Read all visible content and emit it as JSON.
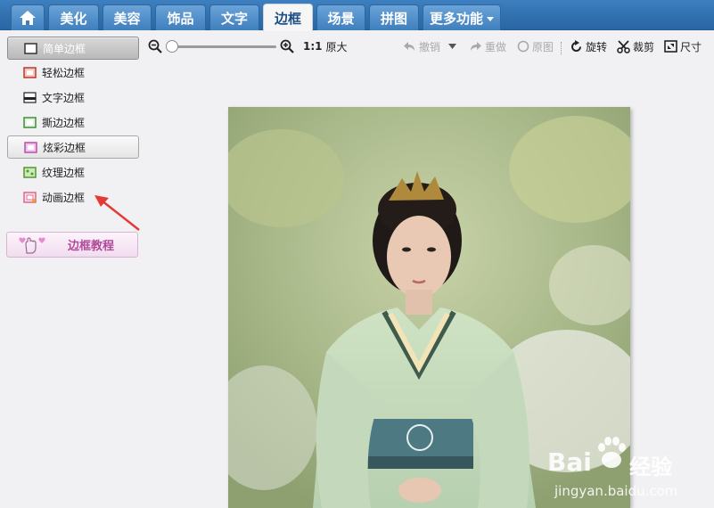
{
  "tabs": [
    {
      "label": "",
      "icon": "home-icon"
    },
    {
      "label": "美化"
    },
    {
      "label": "美容"
    },
    {
      "label": "饰品"
    },
    {
      "label": "文字"
    },
    {
      "label": "边框",
      "active": true
    },
    {
      "label": "场景"
    },
    {
      "label": "拼图"
    },
    {
      "label": "更多功能",
      "has_dropdown": true
    }
  ],
  "sidebar": {
    "items": [
      {
        "label": "简单边框",
        "icon": "simple-frame-icon",
        "state": "selected"
      },
      {
        "label": "轻松边框",
        "icon": "easy-frame-icon"
      },
      {
        "label": "文字边框",
        "icon": "text-frame-icon"
      },
      {
        "label": "撕边边框",
        "icon": "torn-frame-icon"
      },
      {
        "label": "炫彩边框",
        "icon": "colorful-frame-icon",
        "state": "hover"
      },
      {
        "label": "纹理边框",
        "icon": "texture-frame-icon"
      },
      {
        "label": "动画边框",
        "icon": "animated-frame-icon"
      }
    ],
    "tutorial_label": "边框教程"
  },
  "toolbar": {
    "zoom_ratio": "1:1",
    "original_size": "原大",
    "undo": "撤销",
    "redo": "重做",
    "original": "原图",
    "rotate": "旋转",
    "crop": "裁剪",
    "size": "尺寸"
  },
  "watermark": {
    "brand": "Bai",
    "brand_suffix": "经验",
    "url": "jingyan.baidu.com"
  },
  "colors": {
    "tab_bar": "#2f6fae",
    "active_tab_text": "#1d4f86",
    "annotation_arrow": "#e53935",
    "tutorial_text": "#b04a9a"
  }
}
